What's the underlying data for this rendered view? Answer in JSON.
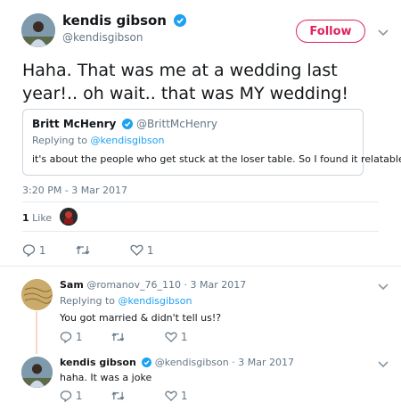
{
  "main_tweet": {
    "author_name": "kendis gibson",
    "author_handle": "@kendisgibson",
    "follow_label": "Follow",
    "text": "Haha. That was me at a wedding last year!.. oh wait.. that was MY wedding!",
    "quoted": {
      "author_name": "Britt McHenry",
      "author_handle": "@BrittMcHenry",
      "replying_prefix": "Replying to ",
      "replying_handle": "@kendisgibson",
      "text": "it's about the people who get stuck at the loser table. So I found it relatable lol"
    },
    "timestamp": "3:20 PM - 3 Mar 2017",
    "likes_count": "1",
    "likes_label": "Like",
    "reply_count": "1",
    "like_count": "1"
  },
  "replies": [
    {
      "author_name": "Sam",
      "author_handle": "@romanov_76_110",
      "date": "· 3 Mar 2017",
      "replying_prefix": "Replying to ",
      "replying_handle": "@kendisgibson",
      "text": "You got married & didn't tell us!?",
      "reply_count": "1",
      "like_count": "1"
    },
    {
      "author_name": "kendis gibson",
      "author_handle": "@kendisgibson",
      "date": "· 3 Mar 2017",
      "text": "haha. It was a joke",
      "reply_count": "1",
      "like_count": "1"
    }
  ],
  "colors": {
    "accent": "#1da1f2",
    "follow": "#e0245e",
    "muted": "#657786",
    "thread_line": "#ffd4c2"
  }
}
